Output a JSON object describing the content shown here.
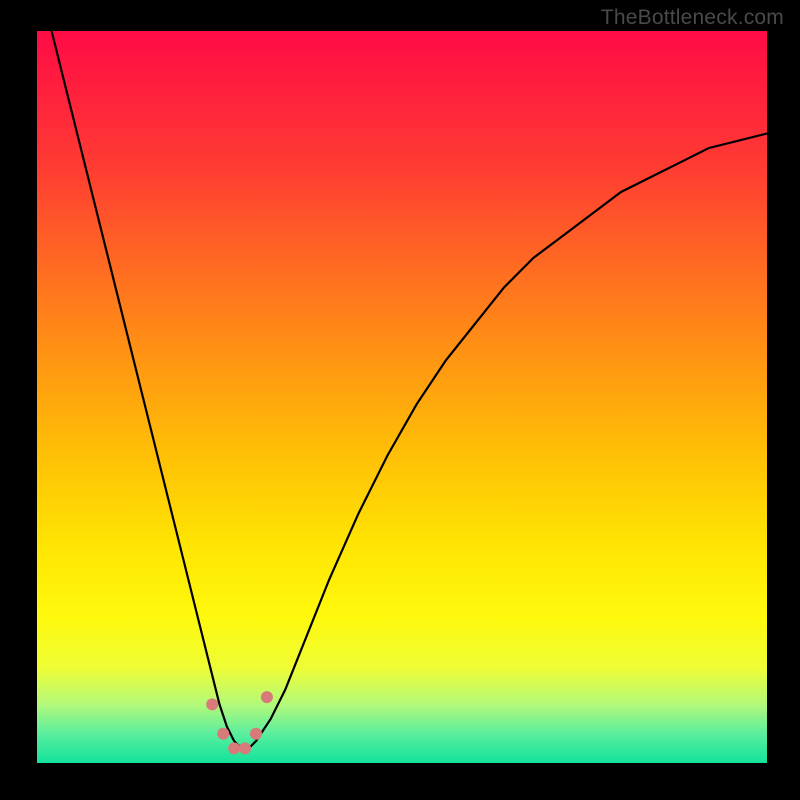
{
  "watermark": "TheBottleneck.com",
  "chart_data": {
    "type": "line",
    "title": "",
    "xlabel": "",
    "ylabel": "",
    "xlim": [
      0,
      100
    ],
    "ylim": [
      0,
      100
    ],
    "series": [
      {
        "name": "bottleneck-curve",
        "x": [
          2,
          4,
          6,
          8,
          10,
          12,
          14,
          16,
          18,
          20,
          22,
          24,
          25,
          26,
          27,
          28,
          29,
          30,
          32,
          34,
          36,
          38,
          40,
          44,
          48,
          52,
          56,
          60,
          64,
          68,
          72,
          76,
          80,
          84,
          88,
          92,
          96,
          100
        ],
        "y": [
          100,
          92,
          84,
          76,
          68,
          60,
          52,
          44,
          36,
          28,
          20,
          12,
          8,
          5,
          3,
          2,
          2,
          3,
          6,
          10,
          15,
          20,
          25,
          34,
          42,
          49,
          55,
          60,
          65,
          69,
          72,
          75,
          78,
          80,
          82,
          84,
          85,
          86
        ]
      }
    ],
    "markers": {
      "name": "highlight-dots",
      "color": "#d97a7a",
      "points": [
        {
          "x": 24.0,
          "y": 8
        },
        {
          "x": 25.5,
          "y": 4
        },
        {
          "x": 27.0,
          "y": 2
        },
        {
          "x": 28.5,
          "y": 2
        },
        {
          "x": 30.0,
          "y": 4
        },
        {
          "x": 31.5,
          "y": 9
        }
      ]
    },
    "gradient_bands": [
      {
        "color": "#ff0b46",
        "stop": 0
      },
      {
        "color": "#ff6a22",
        "stop": 32
      },
      {
        "color": "#ffe403",
        "stop": 70
      },
      {
        "color": "#12e39b",
        "stop": 100
      }
    ]
  }
}
